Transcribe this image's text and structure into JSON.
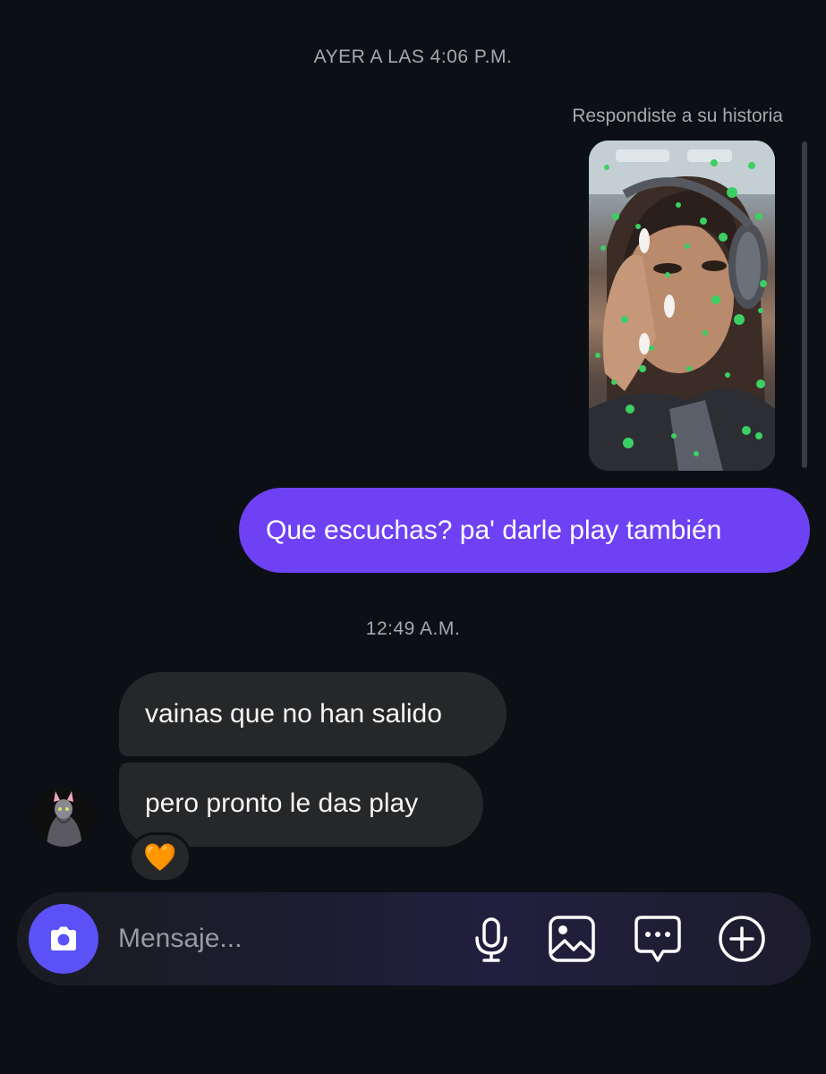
{
  "timestamps": {
    "first": "AYER A LAS 4:06 P.M.",
    "second": "12:49 A.M."
  },
  "story_reply": {
    "label": "Respondiste a su historia"
  },
  "messages": {
    "sent": [
      {
        "text": "Que escuchas? pa' darle play también"
      }
    ],
    "received": [
      {
        "text": "vainas que no han salido"
      },
      {
        "text": "pero pronto le das play"
      }
    ],
    "reaction": "🧡"
  },
  "composer": {
    "placeholder": "Mensaje...",
    "icons": [
      "camera-icon",
      "microphone-icon",
      "gallery-icon",
      "sticker-icon",
      "plus-icon"
    ]
  },
  "colors": {
    "background": "#0c1014",
    "sent_bubble": "#6e41f5",
    "received_bubble": "#262729",
    "camera_button": "#5b51f7"
  }
}
